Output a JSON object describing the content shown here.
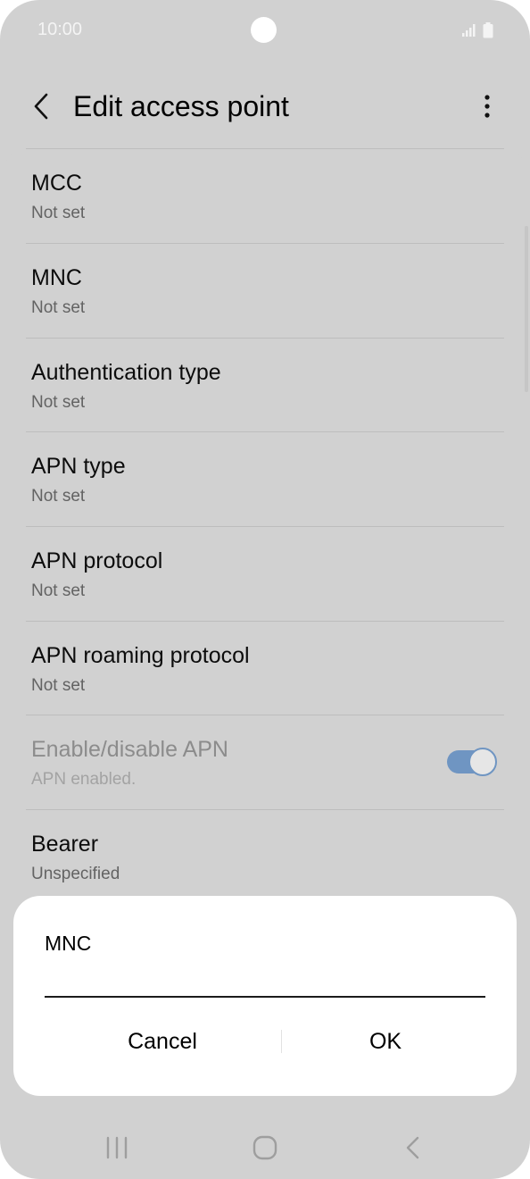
{
  "status_bar": {
    "time": "10:00"
  },
  "app_bar": {
    "title": "Edit access point"
  },
  "settings": [
    {
      "title": "MCC",
      "value": "Not set"
    },
    {
      "title": "MNC",
      "value": "Not set"
    },
    {
      "title": "Authentication type",
      "value": "Not set"
    },
    {
      "title": "APN type",
      "value": "Not set"
    },
    {
      "title": "APN protocol",
      "value": "Not set"
    },
    {
      "title": "APN roaming protocol",
      "value": "Not set"
    },
    {
      "title": "Enable/disable APN",
      "value": "APN enabled.",
      "toggle_on": true,
      "disabled": true
    },
    {
      "title": "Bearer",
      "value": "Unspecified"
    }
  ],
  "dialog": {
    "title": "MNC",
    "input_value": "",
    "cancel_label": "Cancel",
    "ok_label": "OK"
  },
  "colors": {
    "toggle_accent": "#6f95c2",
    "background": "#d1d1d1"
  },
  "icons": [
    "back-arrow-icon",
    "more-options-icon",
    "signal-icon",
    "battery-icon",
    "recent-apps-icon",
    "home-icon",
    "nav-back-icon"
  ]
}
